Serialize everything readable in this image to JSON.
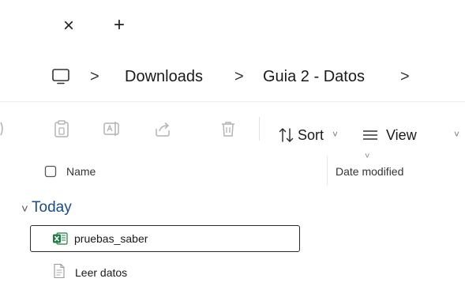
{
  "tabs": {
    "close_glyph": "×",
    "new_glyph": "+"
  },
  "address": {
    "root_icon": "monitor-icon",
    "breadcrumbs": [
      "Downloads",
      "Guia 2 - Datos"
    ],
    "separator": ">"
  },
  "commands": {
    "icons": [
      "new-icon",
      "paste-icon",
      "rename-icon",
      "share-icon",
      "delete-icon"
    ],
    "sort_label": "Sort",
    "view_label": "View",
    "caret": "˅"
  },
  "columns": {
    "name": "Name",
    "date_modified": "Date modified"
  },
  "group": {
    "label": "Today",
    "chevron": "˅"
  },
  "files": [
    {
      "name": "pruebas_saber",
      "icon": "excel-icon",
      "selected": true
    },
    {
      "name": "Leer datos",
      "icon": "text-file-icon",
      "selected": false
    }
  ],
  "colors": {
    "excel_green": "#1f7a44",
    "group_blue": "#1a4b8c",
    "icon_gray": "#b3b3b3"
  }
}
